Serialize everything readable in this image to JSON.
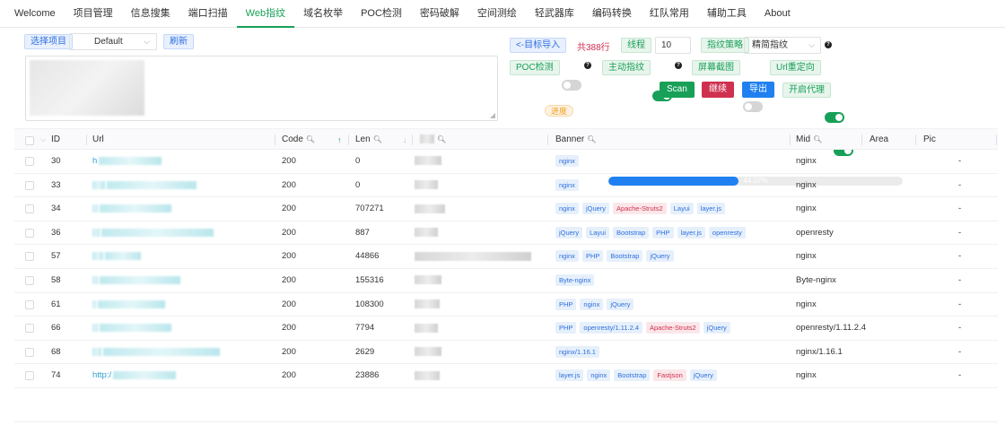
{
  "nav": {
    "items": [
      "Welcome",
      "项目管理",
      "信息搜集",
      "端口扫描",
      "Web指纹",
      "域名枚举",
      "POC检测",
      "密码破解",
      "空间测绘",
      "轻武器库",
      "编码转换",
      "红队常用",
      "辅助工具",
      "About"
    ],
    "active_index": 4
  },
  "project": {
    "label": "选择项目",
    "selected": "Default",
    "refresh_label": "刷新"
  },
  "targets": {
    "import_label": "<-目标导入",
    "count_text": "共388行",
    "thread_label": "线程",
    "thread_value": "10",
    "strategy_label": "指纹策略",
    "strategy_value": "精简指纹"
  },
  "options": {
    "poc_label": "POC检测",
    "poc_on": false,
    "active_fp_label": "主动指纹",
    "active_fp_on": true,
    "screenshot_label": "屏幕截图",
    "screenshot_on": false,
    "redirect_label": "Url重定向",
    "redirect_on": true
  },
  "actions": {
    "scan": "Scan",
    "stop": "继续",
    "export": "导出",
    "proxy_label": "开启代理",
    "proxy_on": true
  },
  "progress": {
    "label": "进度",
    "percent": 44.07,
    "text": "44.07%"
  },
  "table": {
    "columns": [
      "ID",
      "Url",
      "Code",
      "Len",
      "Banner",
      "Mid",
      "Area",
      "Pic"
    ],
    "rows": [
      {
        "id": "30",
        "url": "h",
        "code": "200",
        "len": "0",
        "banner": [
          [
            "nginx",
            "blue"
          ]
        ],
        "mid": "nginx",
        "pic": "-"
      },
      {
        "id": "33",
        "url": "",
        "code": "200",
        "len": "0",
        "banner": [
          [
            "nginx",
            "blue"
          ]
        ],
        "mid": "nginx",
        "pic": "-"
      },
      {
        "id": "34",
        "url": "",
        "code": "200",
        "len": "707271",
        "banner": [
          [
            "nginx",
            "blue"
          ],
          [
            "jQuery",
            "blue"
          ],
          [
            "Apache-Struts2",
            "red"
          ],
          [
            "Layui",
            "blue"
          ],
          [
            "layer.js",
            "blue"
          ]
        ],
        "mid": "nginx",
        "pic": "-"
      },
      {
        "id": "36",
        "url": "",
        "code": "200",
        "len": "887",
        "banner": [
          [
            "jQuery",
            "blue"
          ],
          [
            "Layui",
            "blue"
          ],
          [
            "Bootstrap",
            "blue"
          ],
          [
            "PHP",
            "blue"
          ],
          [
            "layer.js",
            "blue"
          ],
          [
            "openresty",
            "blue"
          ]
        ],
        "mid": "openresty",
        "pic": "-"
      },
      {
        "id": "57",
        "url": "",
        "code": "200",
        "len": "44866",
        "banner": [
          [
            "nginx",
            "blue"
          ],
          [
            "PHP",
            "blue"
          ],
          [
            "Bootstrap",
            "blue"
          ],
          [
            "jQuery",
            "blue"
          ]
        ],
        "mid": "nginx",
        "pic": "-"
      },
      {
        "id": "58",
        "url": "",
        "code": "200",
        "len": "155316",
        "banner": [
          [
            "Byte-nginx",
            "blue"
          ]
        ],
        "mid": "Byte-nginx",
        "pic": "-"
      },
      {
        "id": "61",
        "url": "",
        "code": "200",
        "len": "108300",
        "banner": [
          [
            "PHP",
            "blue"
          ],
          [
            "nginx",
            "blue"
          ],
          [
            "jQuery",
            "blue"
          ]
        ],
        "mid": "nginx",
        "pic": "-"
      },
      {
        "id": "66",
        "url": "",
        "code": "200",
        "len": "7794",
        "banner": [
          [
            "PHP",
            "blue"
          ],
          [
            "openresty/1.11.2.4",
            "blue"
          ],
          [
            "Apache-Struts2",
            "red"
          ],
          [
            "jQuery",
            "blue"
          ]
        ],
        "mid": "openresty/1.11.2.4",
        "pic": "-"
      },
      {
        "id": "68",
        "url": "",
        "code": "200",
        "len": "2629",
        "banner": [
          [
            "nginx/1.16.1",
            "blue"
          ]
        ],
        "mid": "nginx/1.16.1",
        "pic": "-"
      },
      {
        "id": "74",
        "url": "http:/",
        "code": "200",
        "len": "23886",
        "banner": [
          [
            "layer.js",
            "blue"
          ],
          [
            "nginx",
            "blue"
          ],
          [
            "Bootstrap",
            "blue"
          ],
          [
            "Fastjson",
            "red"
          ],
          [
            "jQuery",
            "blue"
          ]
        ],
        "mid": "nginx",
        "pic": "-"
      }
    ]
  }
}
